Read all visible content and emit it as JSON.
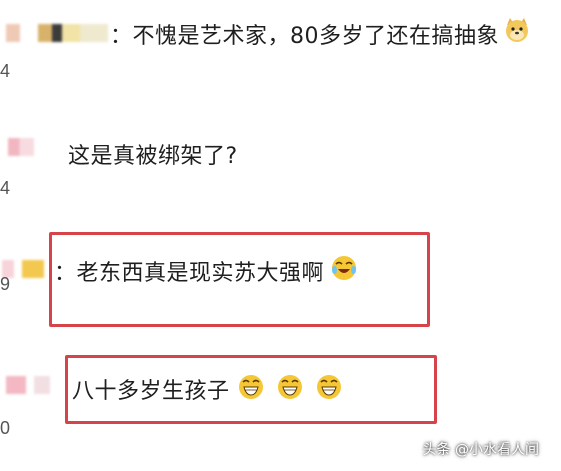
{
  "comments": [
    {
      "text": "：不愧是艺术家，80多岁了还在搞抽象",
      "side_num": "4"
    },
    {
      "text": "这是真被绑架了?",
      "side_num": "4"
    },
    {
      "text": "：老东西真是现实苏大强啊",
      "side_num": "9"
    },
    {
      "text": "八十多岁生孩子",
      "side_num": "0"
    }
  ],
  "watermark": "头条 @小水看人间",
  "colors": {
    "highlight": "#d6434b",
    "emoji": "#f3c21a"
  }
}
